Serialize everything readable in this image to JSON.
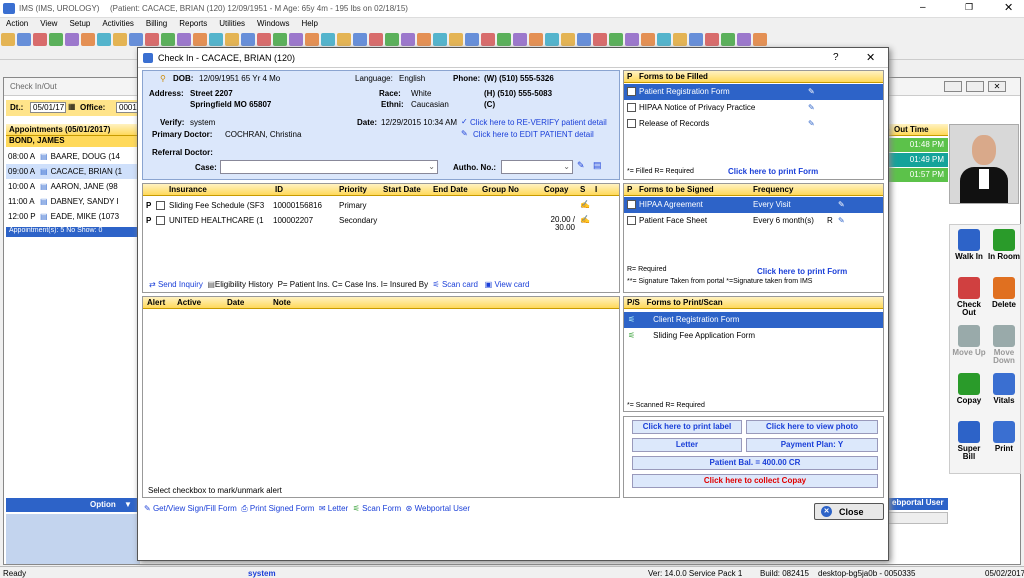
{
  "app": {
    "title": "IMS (IMS, UROLOGY)",
    "patient_info": "(Patient: CACACE, BRIAN  (120) 12/09/1951 - M Age: 65y 4m - 195 lbs on 02/18/15)"
  },
  "menu": [
    "Action",
    "View",
    "Setup",
    "Activities",
    "Billing",
    "Reports",
    "Utilities",
    "Windows",
    "Help"
  ],
  "checkin": {
    "window_title": "Check In/Out",
    "dt_label": "Dt.:",
    "dt_value": "05/01/17",
    "office_label": "Office:",
    "office_value": "0001",
    "appointments_header": "Appointments (05/01/2017)",
    "provider": "BOND, JAMES",
    "appointments": [
      {
        "time": "08:00 A",
        "name": "BAARE, DOUG  (14"
      },
      {
        "time": "09:00 A",
        "name": "CACACE, BRIAN  (1"
      },
      {
        "time": "10:00 A",
        "name": "AARON, JANE  (98"
      },
      {
        "time": "11:00 A",
        "name": "DABNEY, SANDY  I"
      },
      {
        "time": "12:00 P",
        "name": "EADE, MIKE  (1073"
      }
    ],
    "summary": "Appointment(s): 5   No Show: 0",
    "option_label": "Option",
    "time_col": "me",
    "out_col": "Out Time",
    "out_times": [
      "01:48 PM",
      "01:49 PM",
      "01:57 PM"
    ],
    "webportal": "ebportal User",
    "side_buttons": [
      {
        "label": "Walk In",
        "icon": "walk-in-icon"
      },
      {
        "label": "In Room",
        "icon": "in-room-icon"
      },
      {
        "label": "Check Out",
        "icon": "check-out-icon"
      },
      {
        "label": "Delete",
        "icon": "delete-icon"
      },
      {
        "label": "Move Up",
        "icon": "move-up-icon"
      },
      {
        "label": "Move Down",
        "icon": "move-down-icon"
      },
      {
        "label": "Copay",
        "icon": "copay-icon"
      },
      {
        "label": "Vitals",
        "icon": "vitals-icon"
      },
      {
        "label": "Super Bill",
        "icon": "super-bill-icon"
      },
      {
        "label": "Print",
        "icon": "print-icon"
      }
    ]
  },
  "dialog": {
    "title": "Check In - CACACE, BRIAN  (120)",
    "help": "?",
    "close": "✕",
    "dob_label": "DOB:",
    "dob": "12/09/1951  65 Yr 4 Mo",
    "lang_label": "Language:",
    "lang": "English",
    "phone_label": "Phone:",
    "phone_w": "(W)  (510) 555-5326",
    "phone_h": "(H)  (510) 555-5083",
    "phone_c": "(C)",
    "address_label": "Address:",
    "address1": "Street 2207",
    "address2": "Springfield  MO  65807",
    "race_label": "Race:",
    "race": "White",
    "ethni_label": "Ethni:",
    "ethni": "Caucasian",
    "verify_label": "Verify:",
    "verify": "system",
    "date_label": "Date:",
    "date": "12/29/2015 10:34 AM",
    "reverify": "Click here to RE-VERIFY patient detail",
    "edit": "Click here to EDIT PATIENT detail",
    "pcp_label": "Primary Doctor:",
    "pcp": "COCHRAN, Christina",
    "ref_label": "Referral Doctor:",
    "case_label": "Case:",
    "autho_label": "Autho. No.:",
    "ins_headers": [
      "Insurance",
      "ID",
      "Priority",
      "Start Date",
      "End Date",
      "Group No",
      "Copay",
      "S",
      "I"
    ],
    "insurance": [
      {
        "p": "P",
        "name": "Sliding Fee Schedule  (SF3",
        "id": "10000156816",
        "priority": "Primary",
        "copay": ""
      },
      {
        "p": "P",
        "name": "UNITED HEALTHCARE  (1",
        "id": "100002207",
        "priority": "Secondary",
        "copay": "20.00 / 30.00"
      }
    ],
    "ins_toolbar": {
      "send": "Send Inquiry",
      "elig": "Eligibility History",
      "legend": "P= Patient Ins. C= Case Ins. I= Insured By",
      "scan": "Scan card",
      "view": "View card"
    },
    "alert_headers": [
      "Alert",
      "Active",
      "Date",
      "Note"
    ],
    "alert_hint": "Select checkbox to mark/unmark alert",
    "bottom": {
      "getview": "Get/View Sign/Fill Form",
      "printsigned": "Print Signed Form",
      "letter": "Letter",
      "scan": "Scan Form",
      "webportal": "Webportal User",
      "close": "Close"
    },
    "forms_filled": {
      "p": "P",
      "title": "Forms to be Filled",
      "items": [
        "Patient Registration Form",
        "HIPAA Notice of Privacy Practice",
        "Release of Records"
      ],
      "legend": "*= Filled  R= Required",
      "print": "Click here to print Form"
    },
    "forms_signed": {
      "p": "P",
      "title": "Forms to be Signed",
      "freq_title": "Frequency",
      "items": [
        {
          "name": "HIPAA Agreement",
          "freq": "Every Visit",
          "r": ""
        },
        {
          "name": "Patient Face Sheet",
          "freq": "Every 6 month(s)",
          "r": "R"
        }
      ],
      "legend1": "R= Required",
      "legend2": "**= Signature Taken from portal  *=Signature taken from IMS",
      "print": "Click here to print Form"
    },
    "forms_print": {
      "ps": "P/S",
      "title": "Forms to Print/Scan",
      "items": [
        "Client Registration Form",
        "Sliding Fee Application Form"
      ],
      "legend": "*= Scanned   R= Required"
    },
    "actions": {
      "print_label": "Click here to print label",
      "view_photo": "Click here to view photo",
      "letter": "Letter",
      "payment_plan": "Payment Plan: Y",
      "balance": "Patient Bal. = 400.00 CR",
      "collect": "Click here to collect Copay"
    }
  },
  "status": {
    "ready": "Ready",
    "user": "system",
    "ver": "Ver: 14.0.0 Service Pack 1",
    "build": "Build: 082415",
    "machine": "desktop-bg5ja0b - 0050335",
    "date": "05/02/2017"
  },
  "colors": {
    "accent": "#2d63c8",
    "section": "#ffd95a",
    "green_row": "#5cc24a",
    "teal_row": "#14a39a"
  }
}
